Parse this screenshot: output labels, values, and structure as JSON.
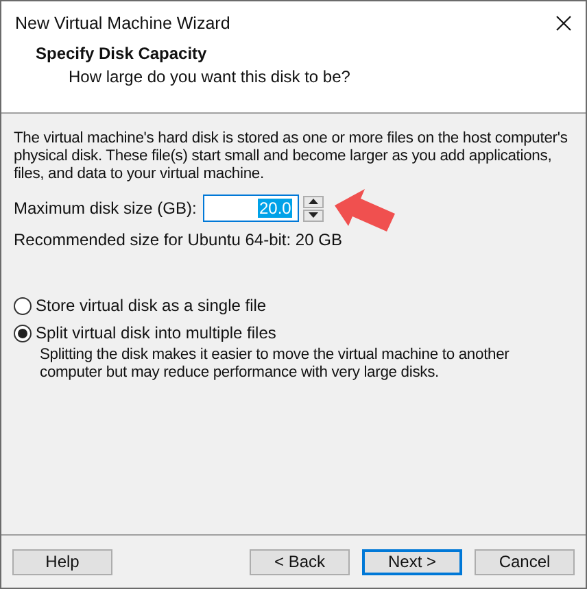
{
  "window": {
    "title": "New Virtual Machine Wizard"
  },
  "header": {
    "title": "Specify Disk Capacity",
    "subtitle": "How large do you want this disk to be?"
  },
  "description": "The virtual machine's hard disk is stored as one or more files on the host computer's physical disk. These file(s) start small and become larger as you add applications, files, and data to your virtual machine.",
  "disk_size": {
    "label": "Maximum disk size (GB):",
    "value": "20.0",
    "focused": true
  },
  "annotation_arrow": true,
  "recommendation": "Recommended size for Ubuntu 64-bit: 20 GB",
  "options": [
    {
      "label": "Store virtual disk as a single file",
      "selected": false
    },
    {
      "label": "Split virtual disk into multiple files",
      "selected": true
    }
  ],
  "option_note": "Splitting the disk makes it easier to move the virtual machine to another computer but may reduce performance with very large disks.",
  "buttons": [
    {
      "label": "Help",
      "default": false
    },
    {
      "label": "< Back",
      "default": false
    },
    {
      "label": "Next >",
      "default": true
    },
    {
      "label": "Cancel",
      "default": false
    }
  ]
}
